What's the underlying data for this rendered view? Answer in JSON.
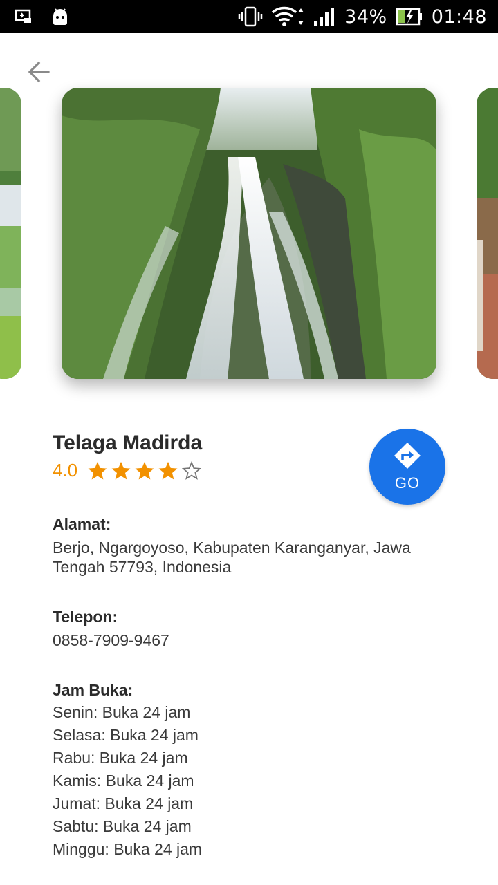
{
  "status_bar": {
    "battery": "34%",
    "time": "01:48"
  },
  "place": {
    "name": "Telaga Madirda",
    "rating": "4.0",
    "rating_stars": 4,
    "rating_max": 5,
    "go_label": "GO",
    "address_label": "Alamat:",
    "address_line1": "Berjo, Ngargoyoso, Kabupaten Karanganyar, Jawa",
    "address_line2": "Tengah 57793, Indonesia",
    "phone_label": "Telepon:",
    "phone": "0858-7909-9467",
    "hours_label": "Jam Buka:",
    "hours": [
      "Senin: Buka 24 jam",
      "Selasa: Buka 24 jam",
      "Rabu: Buka 24 jam",
      "Kamis: Buka 24 jam",
      "Jumat: Buka 24 jam",
      "Sabtu: Buka 24 jam",
      "Minggu: Buka 24 jam"
    ]
  },
  "colors": {
    "accent_blue": "#1a73e8",
    "star_orange": "#f29100"
  },
  "icons": [
    "back-arrow-icon",
    "directions-icon",
    "star-icon",
    "star-outline-icon",
    "vibrate-icon",
    "wifi-icon",
    "signal-icon",
    "battery-charging-icon",
    "screen-cast-icon",
    "android-icon"
  ]
}
